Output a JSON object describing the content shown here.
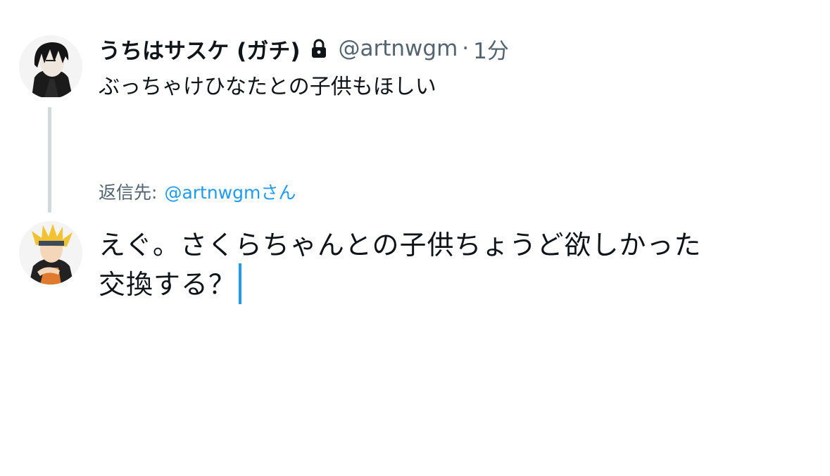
{
  "original_tweet": {
    "display_name": "うちはサスケ (ガチ)",
    "handle": "@artnwgm",
    "separator": "·",
    "time": "1分",
    "text": "ぶっちゃけひなたとの子供もほしい",
    "avatar_icon": "dark-haired-character-avatar",
    "lock_icon": "lock-icon"
  },
  "reply": {
    "reply_to_label": "返信先:",
    "reply_to_handle": "@artnwgmさん",
    "compose_line_1": "えぐ。さくらちゃんとの子供ちょうど欲しかった",
    "compose_line_2": "交換する？",
    "avatar_icon": "blond-character-avatar"
  },
  "colors": {
    "text_primary": "#0f1419",
    "text_secondary": "#536471",
    "accent": "#1d9bf0",
    "thread_line": "#cfd9de"
  }
}
